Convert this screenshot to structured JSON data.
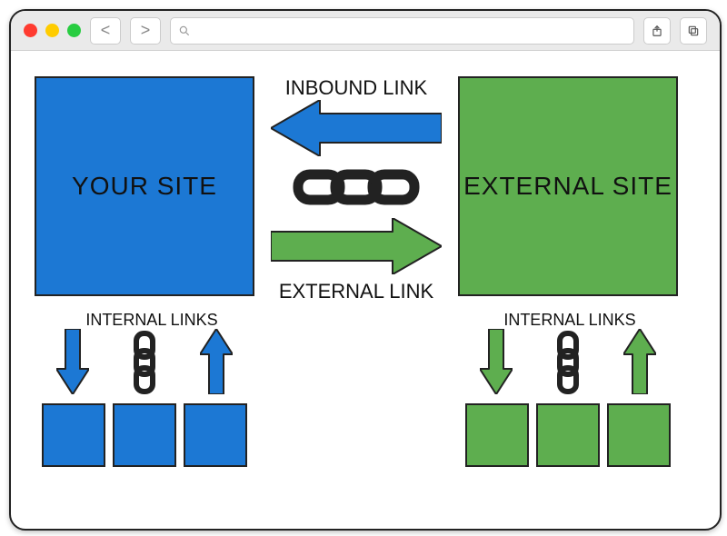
{
  "titlebar": {
    "back_glyph": "<",
    "forward_glyph": ">"
  },
  "colors": {
    "blue": "#1c78d4",
    "green": "#5eae4f"
  },
  "left": {
    "box_label": "YOUR SITE",
    "internal_label": "INTERNAL LINKS"
  },
  "right": {
    "box_label": "EXTERNAL SITE",
    "internal_label": "INTERNAL LINKS"
  },
  "center": {
    "inbound_label": "INBOUND LINK",
    "external_label": "EXTERNAL LINK"
  }
}
